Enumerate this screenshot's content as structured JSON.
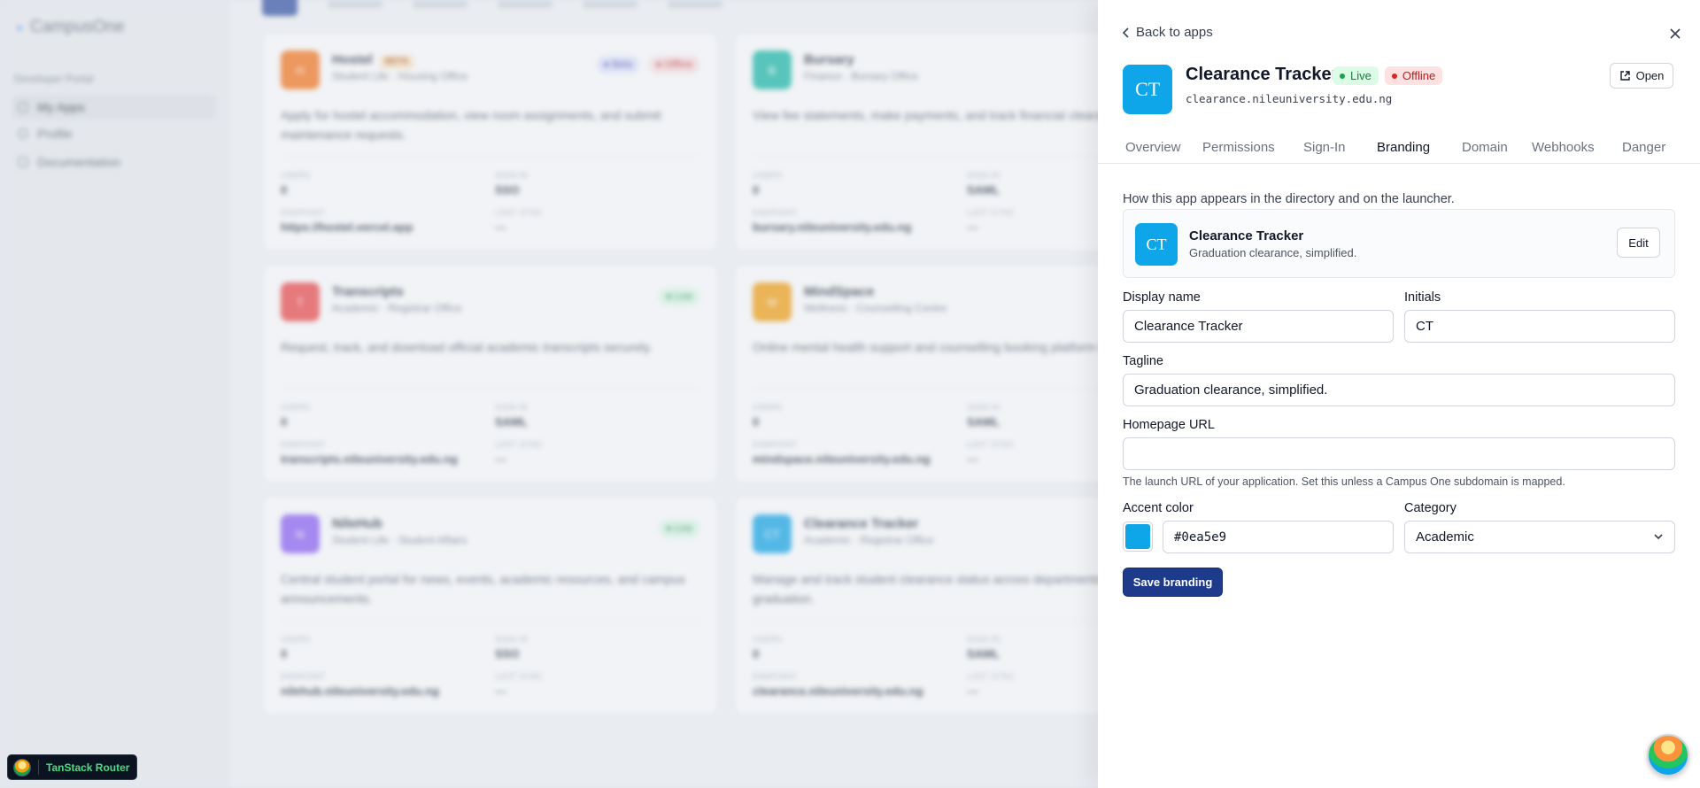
{
  "background": {
    "brand": "CampusOne",
    "section_label": "Developer Portal",
    "nav": [
      "My Apps",
      "Profile",
      "Documentation"
    ],
    "cards": [
      {
        "name": "Hostel",
        "tag": "BETA",
        "subtitle": "Student Life · Housing Office",
        "description": "Apply for hostel accommodation, view room assignments, and submit maintenance requests.",
        "endpoint": "https://hostel.vercel.app",
        "color": "#f97316",
        "badges": [
          {
            "text": "Beta",
            "bg": "#e0e7ff",
            "fg": "#3730a3"
          },
          {
            "text": "Offline",
            "bg": "#fee2e2",
            "fg": "#b91c1c"
          }
        ],
        "users": "0",
        "sign_in": "SSO"
      },
      {
        "name": "Bursary",
        "tag": "",
        "subtitle": "Finance · Bursary Office",
        "description": "View fee statements, make payments, and track financial clearance.",
        "endpoint": "bursary.nileuniversity.edu.ng",
        "color": "#14b8a6",
        "badges": [],
        "users": "0",
        "sign_in": "SAML"
      },
      {
        "name": "Transcripts",
        "tag": "",
        "subtitle": "Academic · Registrar Office",
        "description": "Request, track, and download official academic transcripts securely.",
        "endpoint": "transcripts.nileuniversity.edu.ng",
        "color": "#ef4444",
        "badges": [
          {
            "text": "Live",
            "bg": "#dcfce7",
            "fg": "#15803d"
          }
        ],
        "users": "0",
        "sign_in": "SAML"
      },
      {
        "name": "MindSpace",
        "tag": "",
        "subtitle": "Wellness · Counselling Centre",
        "description": "Online mental health support and counselling booking platform for students.",
        "endpoint": "mindspace.nileuniversity.edu.ng",
        "color": "#f59e0b",
        "badges": [],
        "users": "0",
        "sign_in": "SAML"
      },
      {
        "name": "NileHub",
        "tag": "",
        "subtitle": "Student Life · Student Affairs",
        "description": "Central student portal for news, events, academic resources, and campus announcements.",
        "endpoint": "nilehub.nileuniversity.edu.ng",
        "color": "#8b5cf6",
        "badges": [
          {
            "text": "Live",
            "bg": "#dcfce7",
            "fg": "#15803d"
          }
        ],
        "users": "0",
        "sign_in": "SSO"
      },
      {
        "name": "Clearance Tracker",
        "tag": "",
        "subtitle": "Academic · Registrar Office",
        "description": "Manage and track student clearance status across departments before graduation.",
        "endpoint": "clearance.nileuniversity.edu.ng",
        "color": "#0ea5e9",
        "badges": [],
        "users": "0",
        "sign_in": "SAML"
      }
    ],
    "stat_labels": {
      "users": "USERS",
      "sign_in": "SIGN-IN",
      "endpoint": "ENDPOINT",
      "last_sync": "LAST SYNC"
    },
    "last_sync": "—"
  },
  "drawer": {
    "back_label": "Back to apps",
    "app": {
      "initials": "CT",
      "name": "Clearance Tracker",
      "domain": "clearance.nileuniversity.edu.ng",
      "accent": "#0ea5e9",
      "status_live": "Live",
      "status_offline": "Offline"
    },
    "open_label": "Open",
    "tabs": [
      "Overview",
      "Permissions",
      "Sign-In",
      "Branding",
      "Domain",
      "Webhooks",
      "Danger"
    ],
    "active_tab": "Branding",
    "branding": {
      "intro": "How this app appears in the directory and on the launcher.",
      "preview": {
        "name": "Clearance Tracker",
        "tagline": "Graduation clearance, simplified.",
        "edit_label": "Edit"
      },
      "fields": {
        "display_name": {
          "label": "Display name",
          "value": "Clearance Tracker"
        },
        "initials": {
          "label": "Initials",
          "value": "CT"
        },
        "tagline": {
          "label": "Tagline",
          "value": "Graduation clearance, simplified."
        },
        "homepage_url": {
          "label": "Homepage URL",
          "value": "",
          "help": "The launch URL of your application. Set this unless a Campus One subdomain is mapped."
        },
        "accent_color": {
          "label": "Accent color",
          "value": "#0ea5e9"
        },
        "category": {
          "label": "Category",
          "value": "Academic"
        }
      },
      "save_label": "Save branding"
    }
  },
  "devtools": {
    "label": "TanStack Router"
  }
}
